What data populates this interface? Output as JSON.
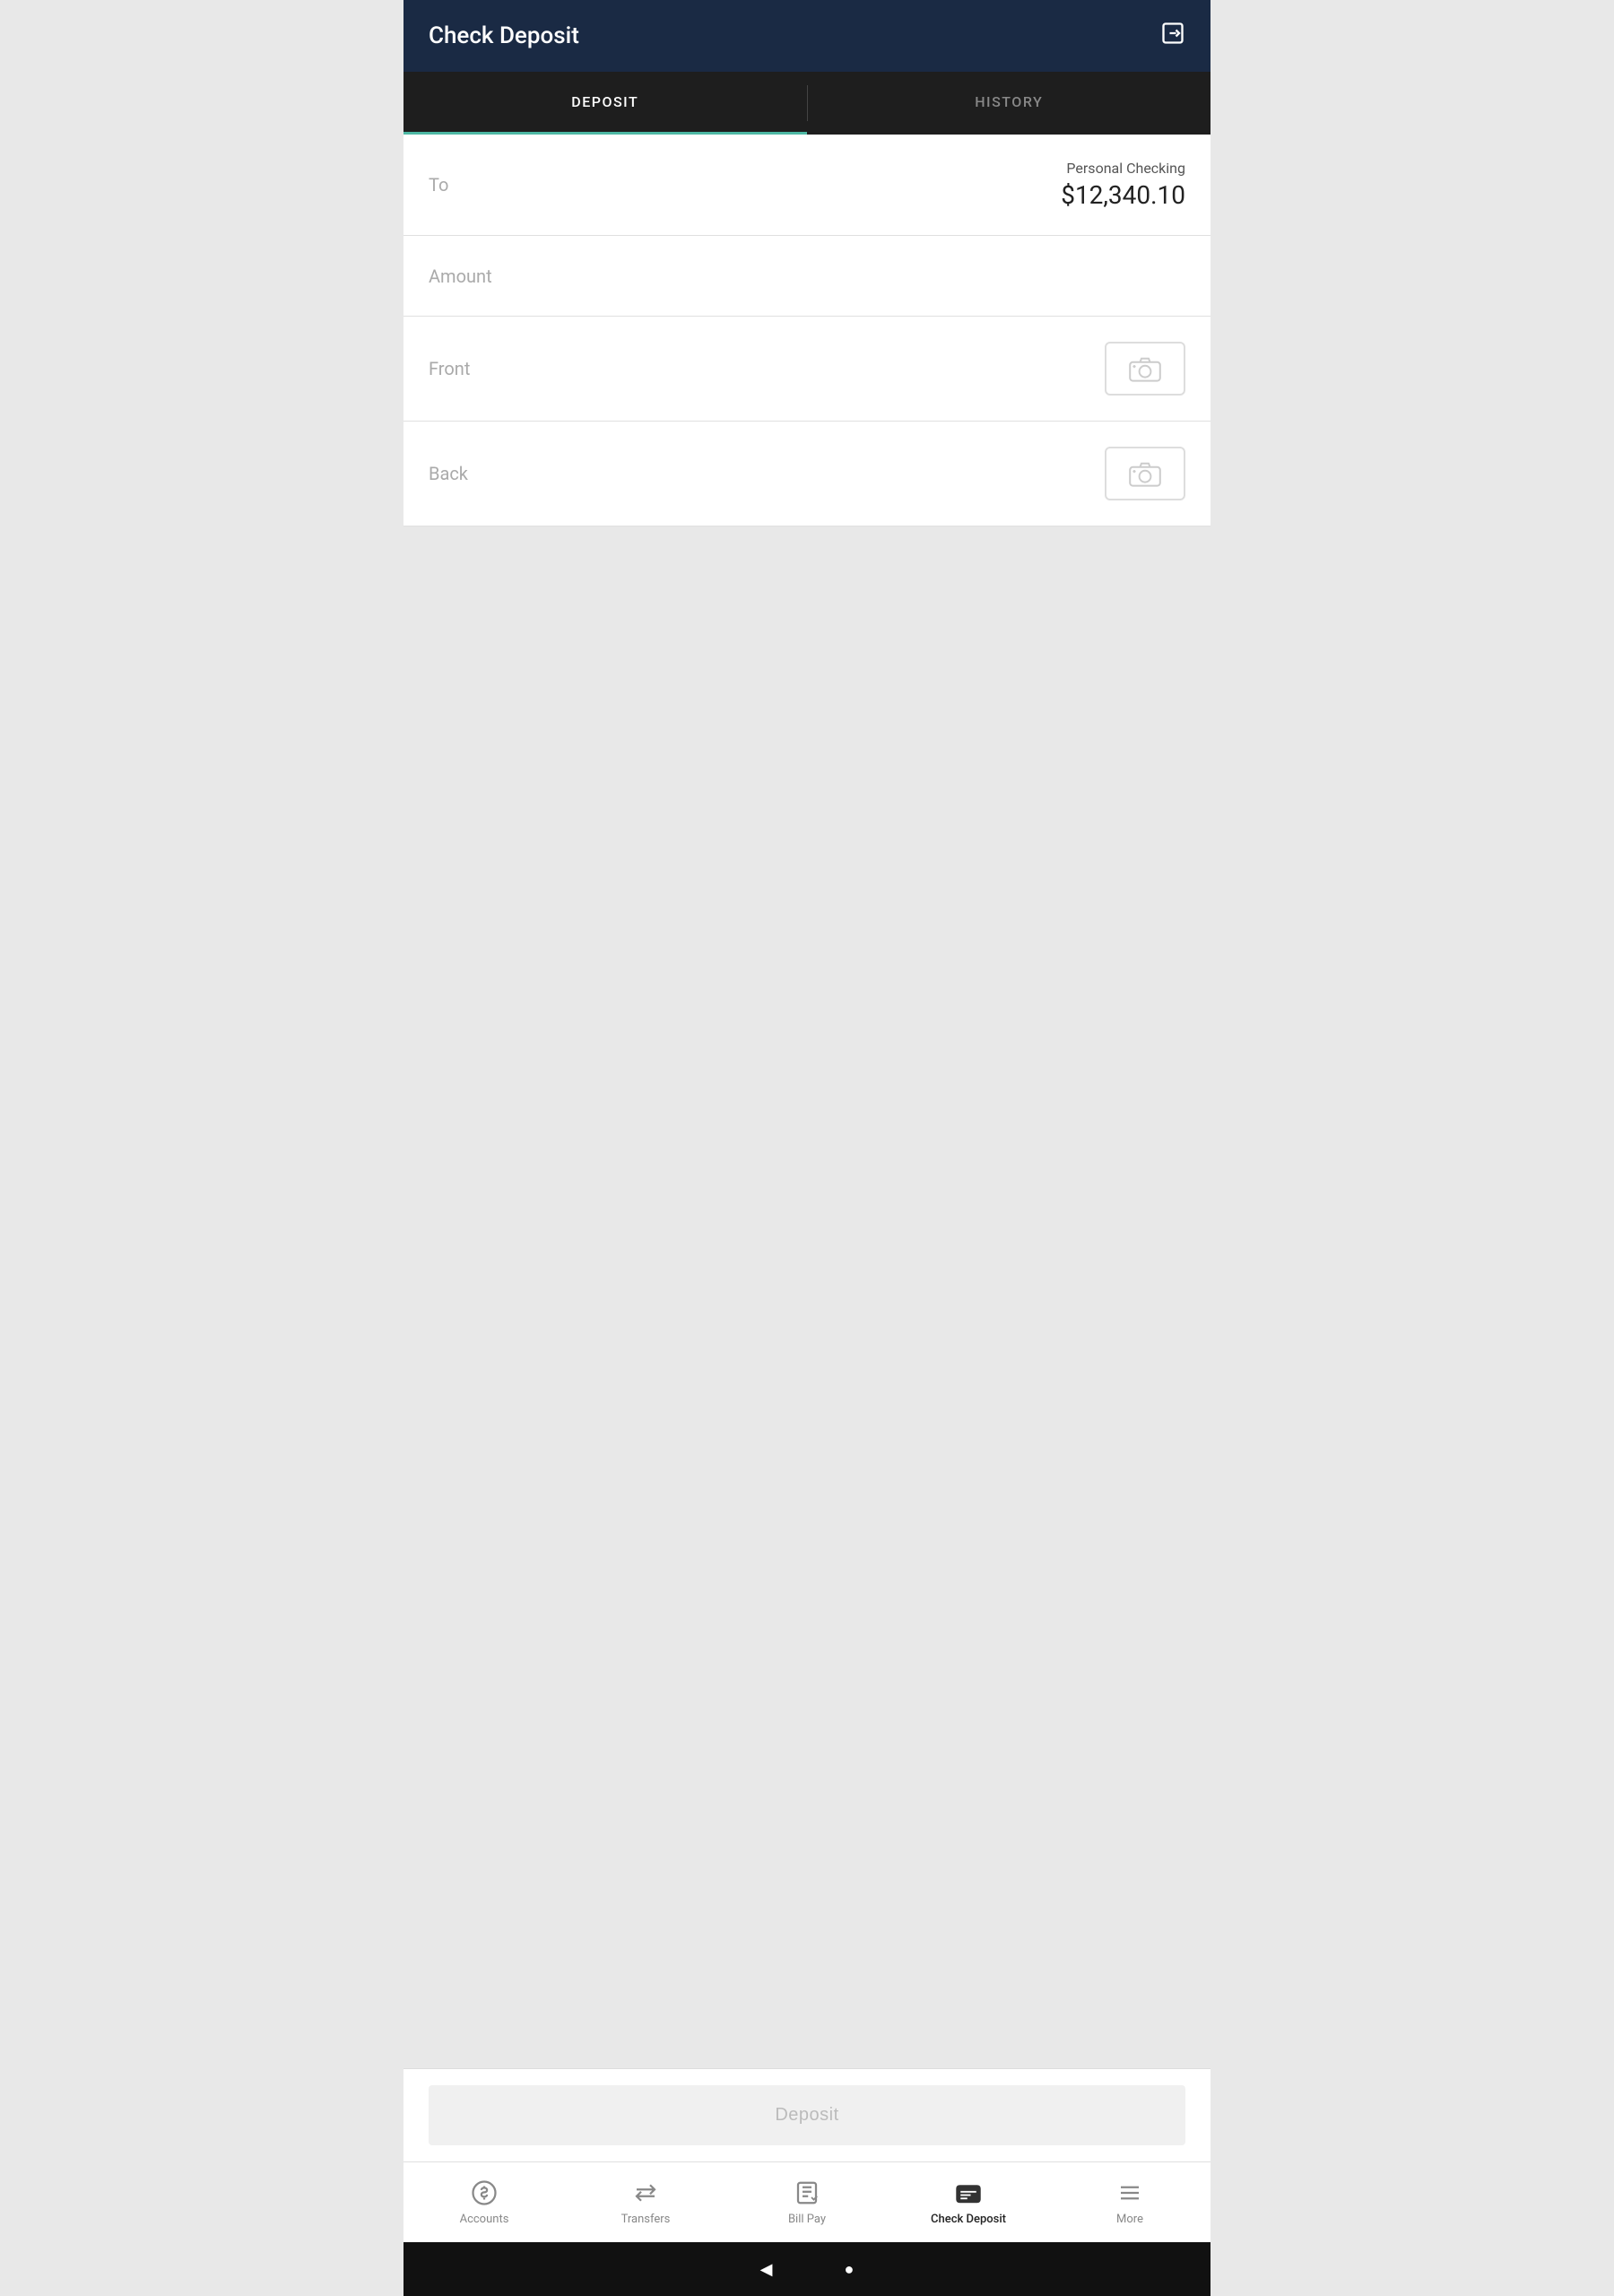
{
  "header": {
    "title": "Check Deposit",
    "exit_icon": "exit-icon"
  },
  "tabs": [
    {
      "id": "deposit",
      "label": "DEPOSIT",
      "active": true
    },
    {
      "id": "history",
      "label": "HISTORY",
      "active": false
    }
  ],
  "form": {
    "to_label": "To",
    "account_name": "Personal Checking",
    "account_balance": "$12,340.10",
    "amount_label": "Amount",
    "front_label": "Front",
    "back_label": "Back"
  },
  "deposit_button": {
    "label": "Deposit"
  },
  "bottom_nav": [
    {
      "id": "accounts",
      "label": "Accounts",
      "icon": "dollar-circle-icon",
      "active": false
    },
    {
      "id": "transfers",
      "label": "Transfers",
      "icon": "transfers-icon",
      "active": false
    },
    {
      "id": "bill-pay",
      "label": "Bill Pay",
      "icon": "bill-pay-icon",
      "active": false
    },
    {
      "id": "check-deposit",
      "label": "Check Deposit",
      "icon": "check-deposit-icon",
      "active": true
    },
    {
      "id": "more",
      "label": "More",
      "icon": "more-icon",
      "active": false
    }
  ],
  "android_nav": {
    "back_label": "◀",
    "home_label": "●"
  },
  "colors": {
    "header_bg": "#1a2a44",
    "tab_bg": "#1e1e1e",
    "active_tab_underline": "#4db8a4",
    "active_tab_text": "#ffffff",
    "inactive_tab_text": "#888888",
    "form_label": "#aaaaaa",
    "deposit_btn_bg": "#f0f0f0",
    "deposit_btn_text": "#bbbbbb"
  }
}
